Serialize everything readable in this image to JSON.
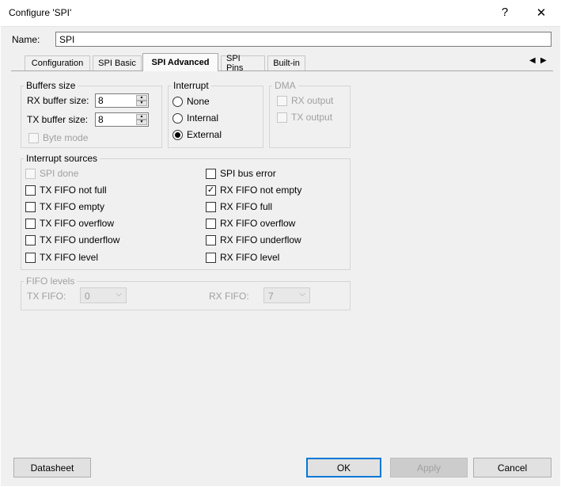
{
  "window": {
    "title": "Configure 'SPI'",
    "help_glyph": "?",
    "close_glyph": "✕"
  },
  "name_field": {
    "label": "Name:",
    "value": "SPI"
  },
  "tabs": [
    {
      "label": "Configuration",
      "active": false
    },
    {
      "label": "SPI Basic",
      "active": false
    },
    {
      "label": "SPI Advanced",
      "active": true
    },
    {
      "label": "SPI Pins",
      "active": false
    },
    {
      "label": "Built-in",
      "active": false
    }
  ],
  "tab_nav": {
    "prev": "◀",
    "next": "▶"
  },
  "buffers": {
    "title": "Buffers size",
    "rx_label": "RX buffer size:",
    "rx_value": "8",
    "tx_label": "TX buffer size:",
    "tx_value": "8",
    "byte_mode": "Byte mode"
  },
  "interrupt": {
    "title": "Interrupt",
    "options": [
      {
        "label": "None",
        "selected": false
      },
      {
        "label": "Internal",
        "selected": false
      },
      {
        "label": "External",
        "selected": true
      }
    ]
  },
  "dma": {
    "title": "DMA",
    "rx": "RX output",
    "tx": "TX output"
  },
  "interrupt_sources": {
    "title": "Interrupt sources",
    "left": [
      {
        "label": "SPI done",
        "checked": false,
        "disabled": true
      },
      {
        "label": "TX FIFO not full",
        "checked": false,
        "disabled": false
      },
      {
        "label": "TX FIFO empty",
        "checked": false,
        "disabled": false
      },
      {
        "label": "TX FIFO overflow",
        "checked": false,
        "disabled": false
      },
      {
        "label": "TX FIFO underflow",
        "checked": false,
        "disabled": false
      },
      {
        "label": "TX FIFO level",
        "checked": false,
        "disabled": false
      }
    ],
    "right": [
      {
        "label": "SPI bus error",
        "checked": false,
        "disabled": false
      },
      {
        "label": "RX FIFO not empty",
        "checked": true,
        "disabled": false
      },
      {
        "label": "RX FIFO full",
        "checked": false,
        "disabled": false
      },
      {
        "label": "RX FIFO overflow",
        "checked": false,
        "disabled": false
      },
      {
        "label": "RX FIFO underflow",
        "checked": false,
        "disabled": false
      },
      {
        "label": "RX FIFO level",
        "checked": false,
        "disabled": false
      }
    ]
  },
  "fifo_levels": {
    "title": "FIFO levels",
    "tx_label": "TX FIFO:",
    "tx_value": "0",
    "rx_label": "RX FIFO:",
    "rx_value": "7"
  },
  "buttons": {
    "datasheet": "Datasheet",
    "ok": "OK",
    "apply": "Apply",
    "cancel": "Cancel"
  },
  "colors": {
    "dialog_bg": "#f0f0f0",
    "default_button_border": "#0078d7",
    "disabled_text": "#a0a0a0"
  }
}
